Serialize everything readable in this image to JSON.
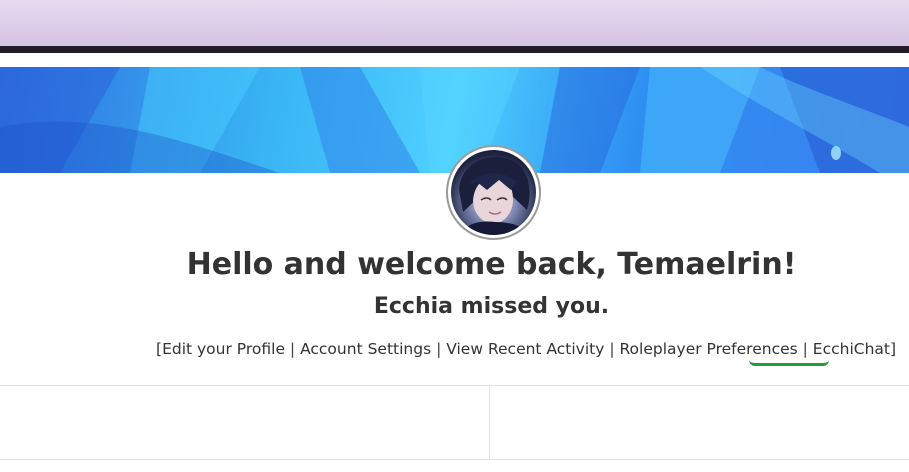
{
  "header": {
    "welcome_prefix": "Hello and welcome back, ",
    "username": "Temaelrin",
    "welcome_suffix": "!",
    "subtitle": "Ecchia missed you."
  },
  "profile_links": {
    "open_bracket": "[",
    "close_bracket": "]",
    "separator": " | ",
    "items": [
      "Edit your Profile",
      "Account Settings",
      "View Recent Activity",
      "Roleplayer Preferences",
      "EcchiChat"
    ]
  },
  "colors": {
    "topbar": "#d6c3e3",
    "topbar_border": "#231c26",
    "banner_blue": "#39b4f4",
    "highlight_underline": "#1e9e3c"
  },
  "icons": {
    "avatar": "user-avatar-image",
    "banner": "profile-banner-image"
  }
}
